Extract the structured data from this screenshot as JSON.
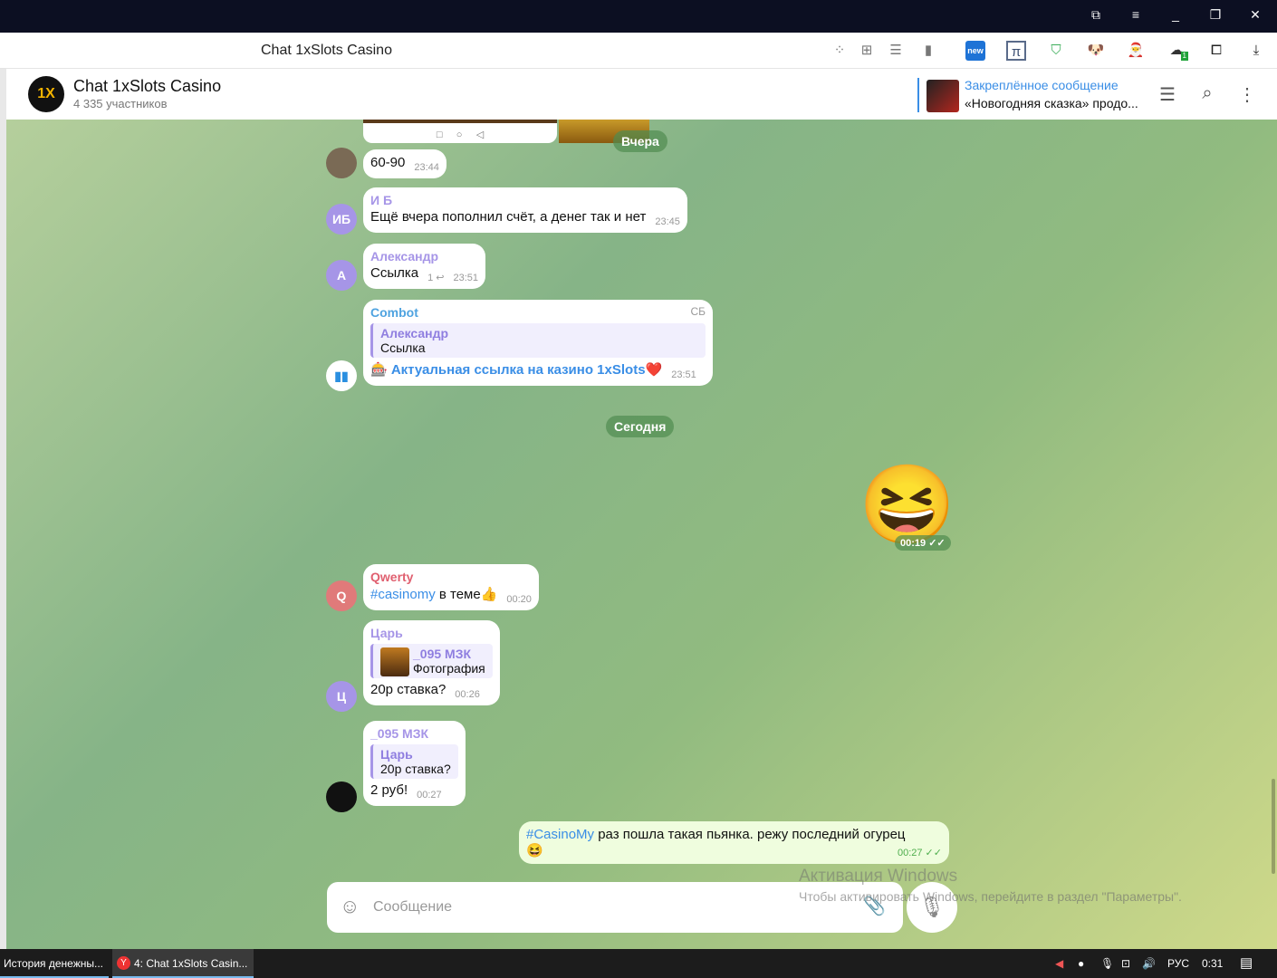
{
  "window": {
    "controls": [
      "⧉",
      "≡",
      "_",
      "❐",
      "✕"
    ]
  },
  "browser": {
    "tab_title": "Chat 1xSlots Casino",
    "extensions": [
      "apps-icon",
      "add-tab-icon",
      "reader-icon",
      "bookmark-icon",
      "new-extension-icon",
      "pi-extension-icon",
      "adguard-icon",
      "dog-extension-icon",
      "avatar-extension-icon",
      "cloud-sync-icon",
      "translate-icon",
      "download-icon"
    ],
    "new_badge": "new",
    "cloud_badge": "1"
  },
  "chat": {
    "title": "Chat 1xSlots Casino",
    "members": "4 335 участников",
    "logo": "1X",
    "pinned": {
      "label": "Закреплённое сообщение",
      "text": "«Новогодняя сказка» продо..."
    }
  },
  "dates": {
    "yesterday": "Вчера",
    "today": "Сегодня"
  },
  "messages": [
    {
      "text": "60-90",
      "time": "23:44"
    },
    {
      "sender": "И Б",
      "avatar": "ИБ",
      "text": "Ещё вчера пополнил счёт, а денег так и нет",
      "time": "23:45"
    },
    {
      "sender": "Александр",
      "avatar": "А",
      "text": "Ссылка",
      "replies": "1 ↩",
      "time": "23:51"
    },
    {
      "sender": "Combot",
      "badge": "СБ",
      "reply_name": "Александр",
      "reply_text": "Ссылка",
      "text": "🎰 Актуальная ссылка на казино 1xSlots❤️",
      "time": "23:51"
    },
    {
      "sticker": "😆",
      "time": "00:19 ✓✓"
    },
    {
      "sender": "Qwerty",
      "avatar": "Q",
      "hashtag": "#casinomy",
      "text": " в теме👍",
      "time": "00:20"
    },
    {
      "sender": "Царь",
      "avatar": "Ц",
      "reply_name": "_095 МЗК",
      "reply_text": "Фотография",
      "text": "20р ставка?",
      "time": "00:26"
    },
    {
      "sender": "_095 МЗК",
      "reply_name": "Царь",
      "reply_text": "20р ставка?",
      "text": "2 руб!",
      "time": "00:27"
    },
    {
      "hashtag": "#CasinoMy",
      "text": " раз пошла такая пьянка. режу последний огурец",
      "emoji": "😆",
      "time": "00:27 ✓✓"
    }
  ],
  "input": {
    "placeholder": "Сообщение"
  },
  "watermark": {
    "title": "Активация Windows",
    "text": "Чтобы активировать Windows, перейдите в раздел \"Параметры\"."
  },
  "taskbar": {
    "items": [
      "История денежны...",
      "4: Chat 1xSlots Casin..."
    ],
    "lang": "РУС",
    "clock": "0:31"
  }
}
